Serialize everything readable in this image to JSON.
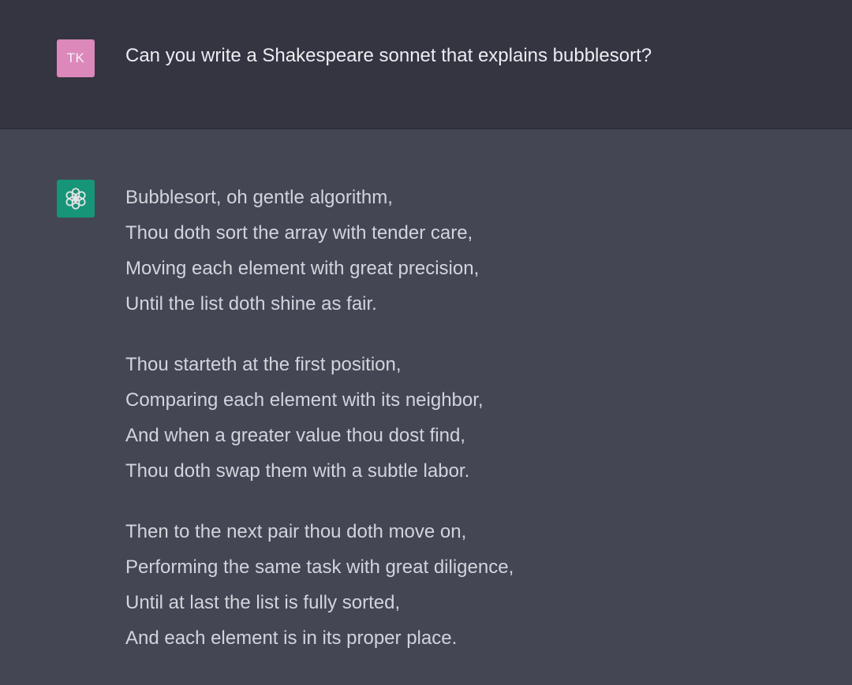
{
  "conversation": {
    "user": {
      "avatar_initials": "TK",
      "avatar_color": "#dd88bb",
      "message": "Can you write a Shakespeare sonnet that explains bubblesort?"
    },
    "assistant": {
      "avatar_icon": "openai-logo-icon",
      "avatar_color": "#10a37f",
      "stanzas": [
        {
          "lines": [
            "Bubblesort, oh gentle algorithm,",
            "Thou doth sort the array with tender care,",
            "Moving each element with great precision,",
            "Until the list doth shine as fair."
          ]
        },
        {
          "lines": [
            "Thou starteth at the first position,",
            "Comparing each element with its neighbor,",
            "And when a greater value thou dost find,",
            "Thou doth swap them with a subtle labor."
          ]
        },
        {
          "lines": [
            "Then to the next pair thou doth move on,",
            "Performing the same task with great diligence,",
            "Until at last the list is fully sorted,",
            "And each element is in its proper place."
          ]
        }
      ]
    }
  }
}
